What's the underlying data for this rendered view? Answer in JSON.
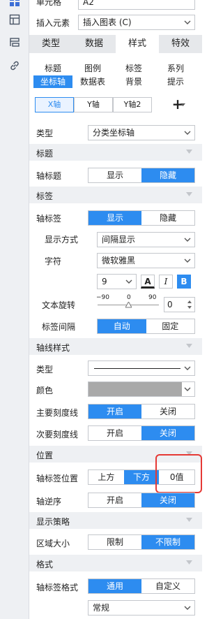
{
  "sidebar_icons": [
    "grid-icon",
    "table-icon",
    "layers-icon",
    "link-icon"
  ],
  "top": {
    "cell_label": "单元格",
    "cell_value": "A2",
    "insert_label": "插入元素",
    "insert_value": "插入图表 (C)"
  },
  "tabs": [
    "类型",
    "数据",
    "样式",
    "特效"
  ],
  "active_tab": "样式",
  "subtabs_row1": [
    "标题",
    "图例",
    "标签",
    "系列"
  ],
  "subtabs_row2": [
    "坐标轴",
    "数据表",
    "背景",
    "提示"
  ],
  "axis_tabs": [
    "X轴",
    "Y轴",
    "Y轴2"
  ],
  "add_symbol": "+",
  "type_label": "类型",
  "type_value": "分类坐标轴",
  "sections": {
    "title": "标题",
    "label": "标签",
    "axisline": "轴线样式",
    "position": "位置",
    "display": "显示策略",
    "format": "格式"
  },
  "axis_title": {
    "label": "轴标题",
    "options": [
      "显示",
      "隐藏"
    ]
  },
  "axis_label": {
    "label": "轴标签",
    "options": [
      "显示",
      "隐藏"
    ]
  },
  "display_mode": {
    "label": "显示方式",
    "value": "间隔显示"
  },
  "font": {
    "label": "字符",
    "value": "微软雅黑",
    "size": "9",
    "A": "A",
    "I": "I",
    "B": "B"
  },
  "rotate": {
    "label": "文本旋转",
    "min": "−90",
    "mid": "0",
    "max": "90",
    "value": "0"
  },
  "interval": {
    "label": "标签间隔",
    "options": [
      "自动",
      "固定"
    ]
  },
  "line_type": {
    "label": "类型"
  },
  "line_color": {
    "label": "颜色",
    "color": "#a9a9a9"
  },
  "major_tick": {
    "label": "主要刻度线",
    "options": [
      "开启",
      "关闭"
    ]
  },
  "minor_tick": {
    "label": "次要刻度线",
    "options": [
      "开启",
      "关闭"
    ]
  },
  "label_pos": {
    "label": "轴标签位置",
    "options": [
      "上方",
      "下方",
      "0值"
    ]
  },
  "reverse": {
    "label": "轴逆序",
    "options": [
      "开启",
      "关闭"
    ]
  },
  "area": {
    "label": "区域大小",
    "options": [
      "限制",
      "不限制"
    ]
  },
  "fmt": {
    "label": "轴标签格式",
    "options": [
      "通用",
      "自定义"
    ],
    "value": "常规"
  },
  "accent": "#2d8cf0",
  "highlight": "#e53935"
}
